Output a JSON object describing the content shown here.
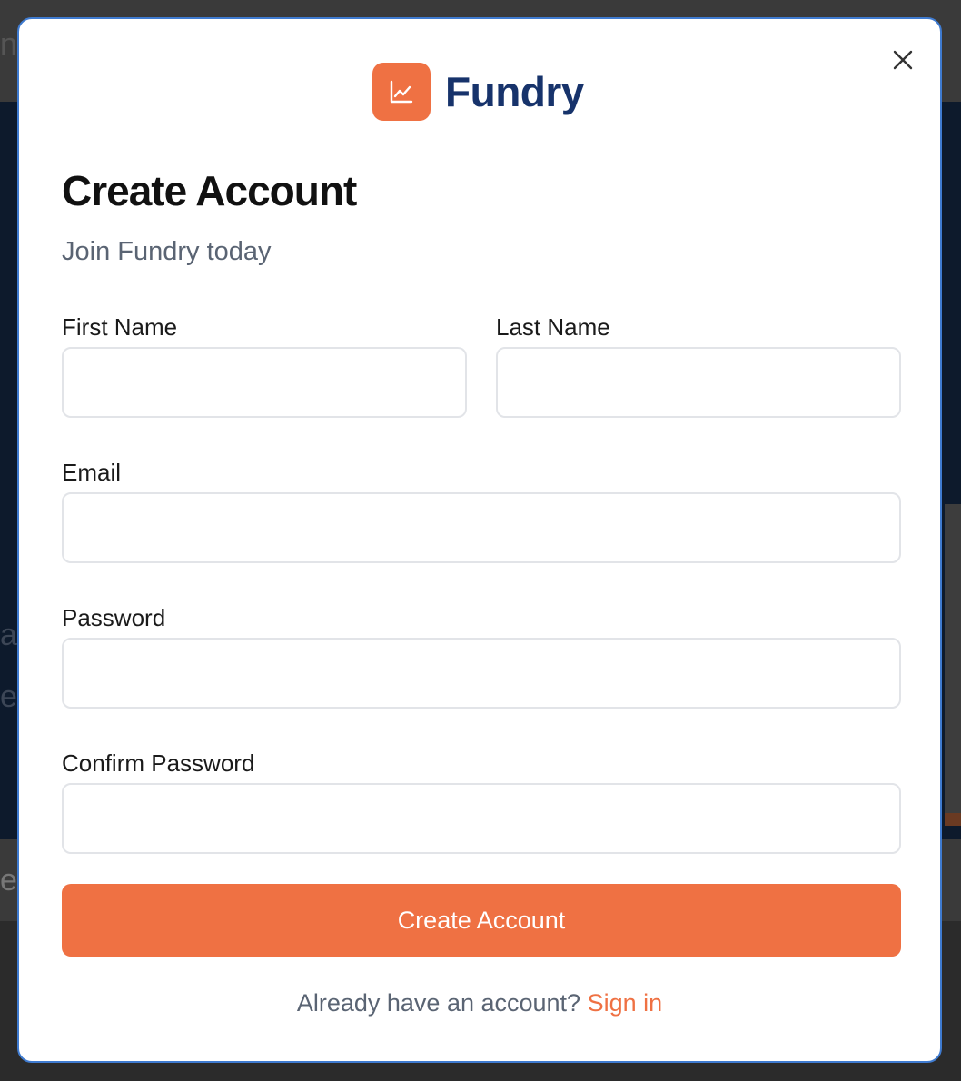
{
  "background": {
    "fragments": [
      "n",
      "a",
      "e",
      "e"
    ]
  },
  "modal": {
    "close_icon": "close-icon",
    "brand": {
      "logo_icon": "line-chart-icon",
      "name": "Fundry",
      "logo_color": "#ef7143",
      "name_color": "#17336b"
    },
    "title": "Create Account",
    "subtitle": "Join Fundry today",
    "fields": {
      "first_name": {
        "label": "First Name",
        "value": "",
        "placeholder": ""
      },
      "last_name": {
        "label": "Last Name",
        "value": "",
        "placeholder": ""
      },
      "email": {
        "label": "Email",
        "value": "",
        "placeholder": ""
      },
      "password": {
        "label": "Password",
        "value": "",
        "placeholder": ""
      },
      "confirm_password": {
        "label": "Confirm Password",
        "value": "",
        "placeholder": ""
      }
    },
    "submit_label": "Create Account",
    "footer": {
      "prompt": "Already have an account?",
      "link": "Sign in"
    },
    "accent_color": "#ef7143",
    "border_color": "#3f7bd0"
  }
}
